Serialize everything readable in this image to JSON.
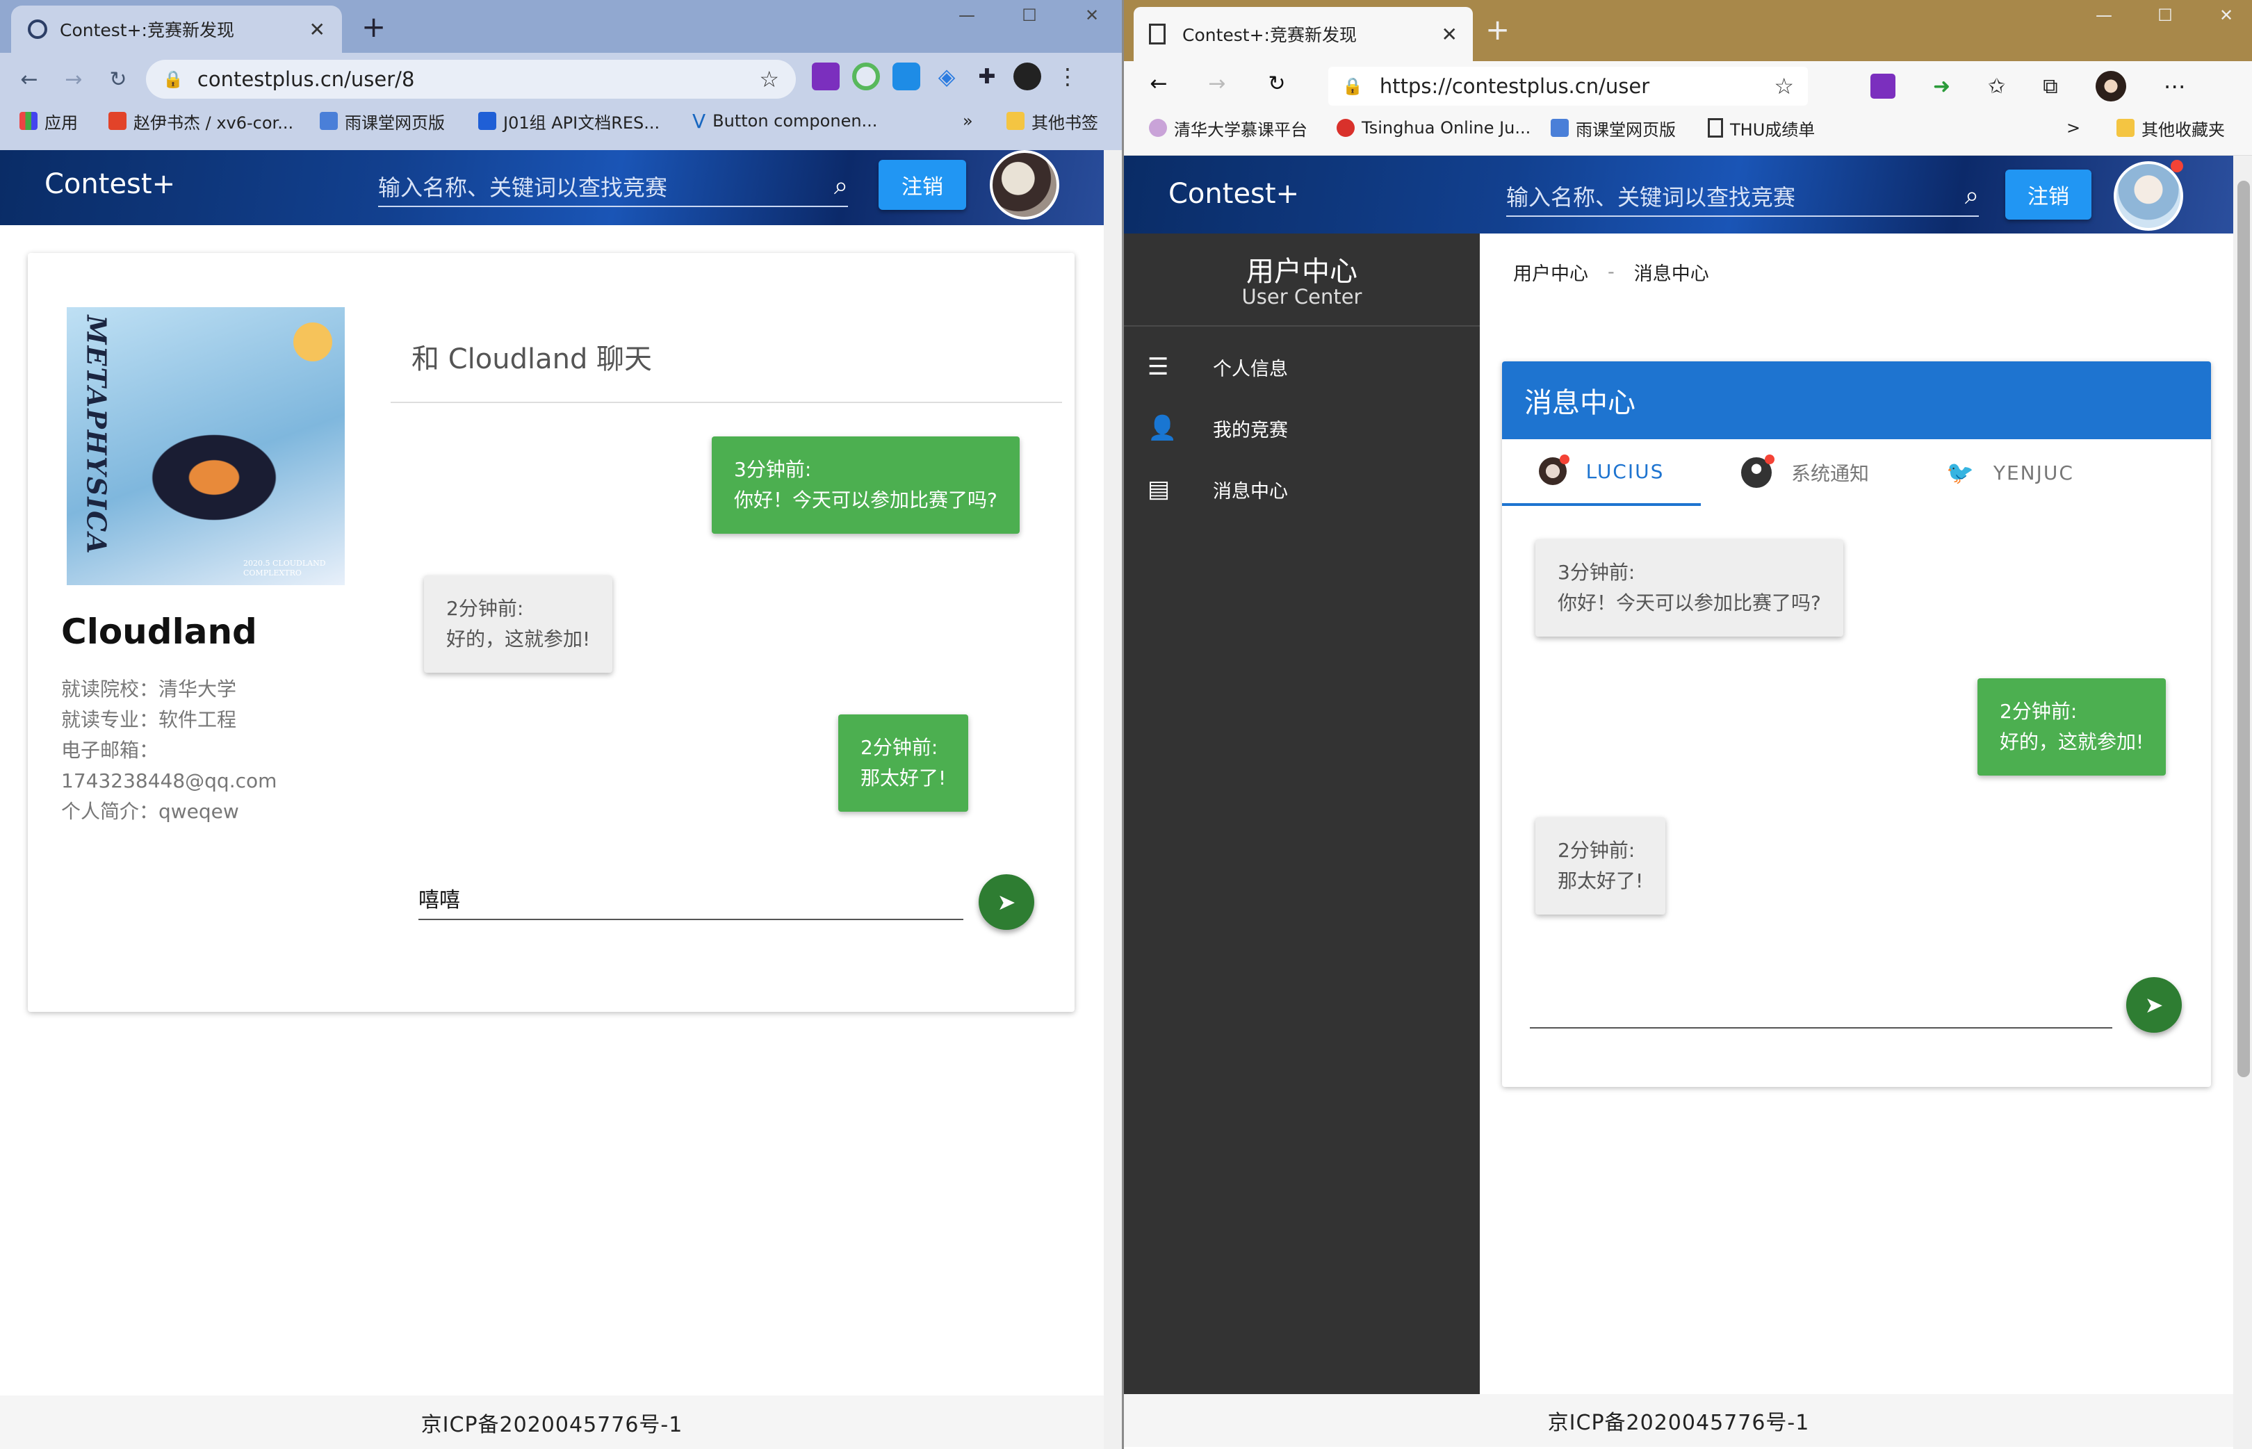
{
  "left": {
    "tab_title": "Contest+:竞赛新发现",
    "url": "contestplus.cn/user/8",
    "bookmarks": [
      "应用",
      "赵伊书杰 / xv6-cor...",
      "雨课堂网页版",
      "J01组 API文档RES...",
      "Button componen...",
      "»",
      "其他书签"
    ],
    "app": {
      "logo": "Contest+",
      "search_placeholder": "输入名称、关键词以查找竞赛",
      "logout": "注销"
    },
    "profile": {
      "cover_title": "METAPHYSICA",
      "cover_caption": "2020.5 CLOUDLAND COMPLEXTRO",
      "name": "Cloudland",
      "school": "就读院校：清华大学",
      "major": "就读专业：软件工程",
      "email_label": "电子邮箱：",
      "email": "1743238448@qq.com",
      "bio": "个人简介：qweqew"
    },
    "chat": {
      "title": "和 Cloudland 聊天",
      "messages": [
        {
          "time": "3分钟前:",
          "text": "你好！今天可以参加比赛了吗?"
        },
        {
          "time": "2分钟前:",
          "text": "好的，这就参加!"
        },
        {
          "time": "2分钟前:",
          "text": "那太好了!"
        }
      ],
      "input_value": "嘻嘻"
    },
    "footer": "京ICP备2020045776号-1"
  },
  "right": {
    "tab_title": "Contest+:竞赛新发现",
    "url": "https://contestplus.cn/user",
    "bookmarks": [
      "清华大学慕课平台",
      "Tsinghua Online Ju...",
      "雨课堂网页版",
      "THU成绩单",
      ">",
      "其他收藏夹"
    ],
    "app": {
      "logo": "Contest+",
      "search_placeholder": "输入名称、关键词以查找竞赛",
      "logout": "注销"
    },
    "sidebar": {
      "title": "用户中心",
      "subtitle": "User Center",
      "items": [
        "个人信息",
        "我的竞赛",
        "消息中心"
      ]
    },
    "breadcrumb": {
      "root": "用户中心",
      "sep": "-",
      "current": "消息中心"
    },
    "panel_title": "消息中心",
    "tabs": [
      "LUCIUS",
      "系统通知",
      "YENJUC"
    ],
    "messages": [
      {
        "time": "3分钟前:",
        "text": "你好！今天可以参加比赛了吗?"
      },
      {
        "time": "2分钟前:",
        "text": "好的，这就参加!"
      },
      {
        "time": "2分钟前:",
        "text": "那太好了!"
      }
    ],
    "footer": "京ICP备2020045776号-1"
  },
  "colors": {
    "chrome_frame": "#91a8d0",
    "edge_frame": "#a8884a",
    "accent_blue": "#1e74d0",
    "green_bubble": "#4caf50",
    "send_button": "#2e7d32",
    "sidebar_dark": "#333333"
  }
}
